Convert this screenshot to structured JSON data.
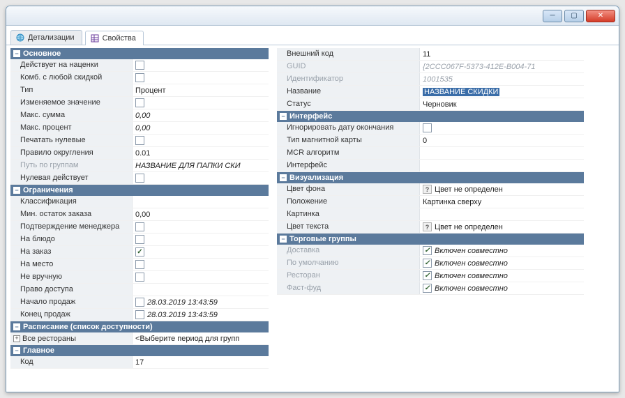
{
  "tabs": {
    "detalizacii": "Детализации",
    "svoistva": "Свойства"
  },
  "left": {
    "sections": {
      "osnovnoe": "Основное",
      "ogranicheniya": "Ограничения",
      "raspisanie": "Расписание (список доступности)",
      "glavnoe": "Главное"
    },
    "rows": {
      "deistvuet_na_nacenki": "Действует на наценки",
      "komb_s_luboi_skidkoi": "Комб. с любой скидкой",
      "tip": "Тип",
      "tip_val": "Процент",
      "izmenyaemoe_znachenie": "Изменяемое значение",
      "maks_summa": "Макс. сумма",
      "maks_summa_val": "0,00",
      "maks_procent": "Макс. процент",
      "maks_procent_val": "0,00",
      "pechatat_nulevye": "Печатать нулевые",
      "pravilo_okrugleniya": "Правило округления",
      "pravilo_okrugleniya_val": "0.01",
      "put_po_gruppam": "Путь по группам",
      "put_po_gruppam_val": "НАЗВАНИЕ ДЛЯ ПАПКИ СКИ",
      "nulevaya_deistvuet": "Нулевая действует",
      "klassifikaciya": "Классификация",
      "min_ostatok_zakaza": "Мин. остаток заказа",
      "min_ostatok_zakaza_val": "0,00",
      "podtverzhdenie_menedzhera": "Подтверждение менеджера",
      "na_bludo": "На блюдо",
      "na_zakaz": "На заказ",
      "na_mesto": "На место",
      "ne_vruchnuyu": "Не вручную",
      "pravo_dostupa": "Право доступа",
      "nachalo_prodazh": "Начало продаж",
      "nachalo_prodazh_val": "28.03.2019 13:43:59",
      "konec_prodazh": "Конец продаж",
      "konec_prodazh_val": "28.03.2019 13:43:59",
      "vse_restorany": "Все рестораны",
      "vse_restorany_val": "<Выберите период для групп",
      "kod": "Код",
      "kod_val": "17"
    }
  },
  "right": {
    "sections": {
      "interfeis": "Интерфейс",
      "vizualizaciya": "Визуализация",
      "torgovye_gruppy": "Торговые группы"
    },
    "rows": {
      "vneshniy_kod": "Внешний код",
      "vneshniy_kod_val": "11",
      "guid": "GUID",
      "guid_val": "{2CCC067F-5373-412E-B004-71",
      "identifikator": "Идентификатор",
      "identifikator_val": "1001535",
      "nazvanie": "Название",
      "nazvanie_val": "НАЗВАНИЕ СКИДКИ",
      "status": "Статус",
      "status_val": "Черновик",
      "ignorirovat_datu": "Игнорировать дату окончания",
      "tip_magn_karty": "Тип магнитной карты",
      "tip_magn_karty_val": "0",
      "mcr_algoritm": "MCR алгоритм",
      "interfeis": "Интерфейс",
      "cvet_fona": "Цвет фона",
      "cvet_ne_opredelen": "Цвет не определен",
      "polozhenie": "Положение",
      "polozhenie_val": "Картинка сверху",
      "kartinka": "Картинка",
      "cvet_teksta": "Цвет текста",
      "dostavka": "Доставка",
      "po_umolchaniyu": "По умолчанию",
      "restoran": "Ресторан",
      "fast_fud": "Фаст-фуд",
      "vklyuchen": "Включен совместно"
    }
  }
}
